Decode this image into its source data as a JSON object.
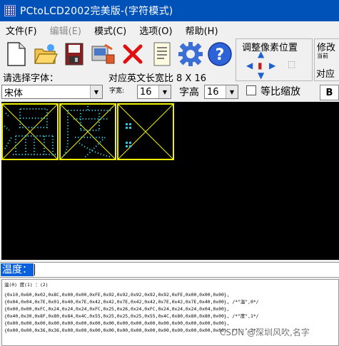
{
  "window": {
    "title": "PCtoLCD2002完美版-(字符模式)",
    "icon": "lcd-app-icon"
  },
  "menu": [
    {
      "label": "文件(F)",
      "enabled": true
    },
    {
      "label": "编辑(E)",
      "enabled": false
    },
    {
      "label": "模式(C)",
      "enabled": true
    },
    {
      "label": "选项(O)",
      "enabled": true
    },
    {
      "label": "帮助(H)",
      "enabled": true
    }
  ],
  "toolbar": {
    "buttons": [
      "new-icon",
      "open-icon",
      "save-icon",
      "settings-icon",
      "delete-icon",
      "notes-icon",
      "gear-icon",
      "help-icon"
    ]
  },
  "adjust_group": {
    "title": "调整像素位置"
  },
  "modify_group": {
    "title": "修改",
    "subtitle": "当前",
    "position_label": "对应"
  },
  "font_panel": {
    "prompt": "请选择字体：",
    "size_info_label": "对应英文长宽比",
    "size_info_value": "8 X 16",
    "font_value": "宋体",
    "width_label": "字宽:",
    "width_value": "16",
    "height_label": "字高",
    "height_value": "16",
    "ratio_label": "等比缩放",
    "bold_label": "B"
  },
  "colors": {
    "title_bar": "#0052b8",
    "grid_border": "#f0ef00",
    "pixel_on": "#34c6d8",
    "canvas_bg": "#000000",
    "selection": "#0a5fdc"
  },
  "edit": {
    "text": "温度："
  },
  "output": {
    "index_line": "温(0) 度(1) ：(2)",
    "lines": [
      "{0x10,0x60,0x02,0x8C,0x00,0x00,0xFE,0x92,0x92,0x92,0x92,0x92,0xFE,0x00,0x00,0x00},",
      "{0x04,0x04,0x7E,0x01,0x40,0x7E,0x42,0x42,0x7E,0x42,0x42,0x7E,0x42,0x7E,0x40,0x00}, /*\"温\",0*/",
      "{0x00,0x00,0xFC,0x24,0x24,0x24,0xFC,0x25,0x26,0x24,0xFC,0x24,0x24,0x24,0x04,0x00},",
      "{0x40,0x30,0x8F,0x80,0x84,0x4C,0x55,0x25,0x25,0x25,0x55,0x4C,0x80,0x80,0x80,0x00}, /*\"度\",1*/",
      "{0x00,0x00,0x00,0x00,0x00,0x00,0x00,0x00,0x00,0x00,0x00,0x00,0x00,0x00,0x00,0x00},",
      "{0x00,0x00,0x36,0x36,0x00,0x00,0x00,0x00,0x00,0x00,0x00,0x00,0x00,0x00,0x00,0x00}, /*\"：\",2*/"
    ],
    "watermark": "CSDN @深圳风吹,名字"
  }
}
